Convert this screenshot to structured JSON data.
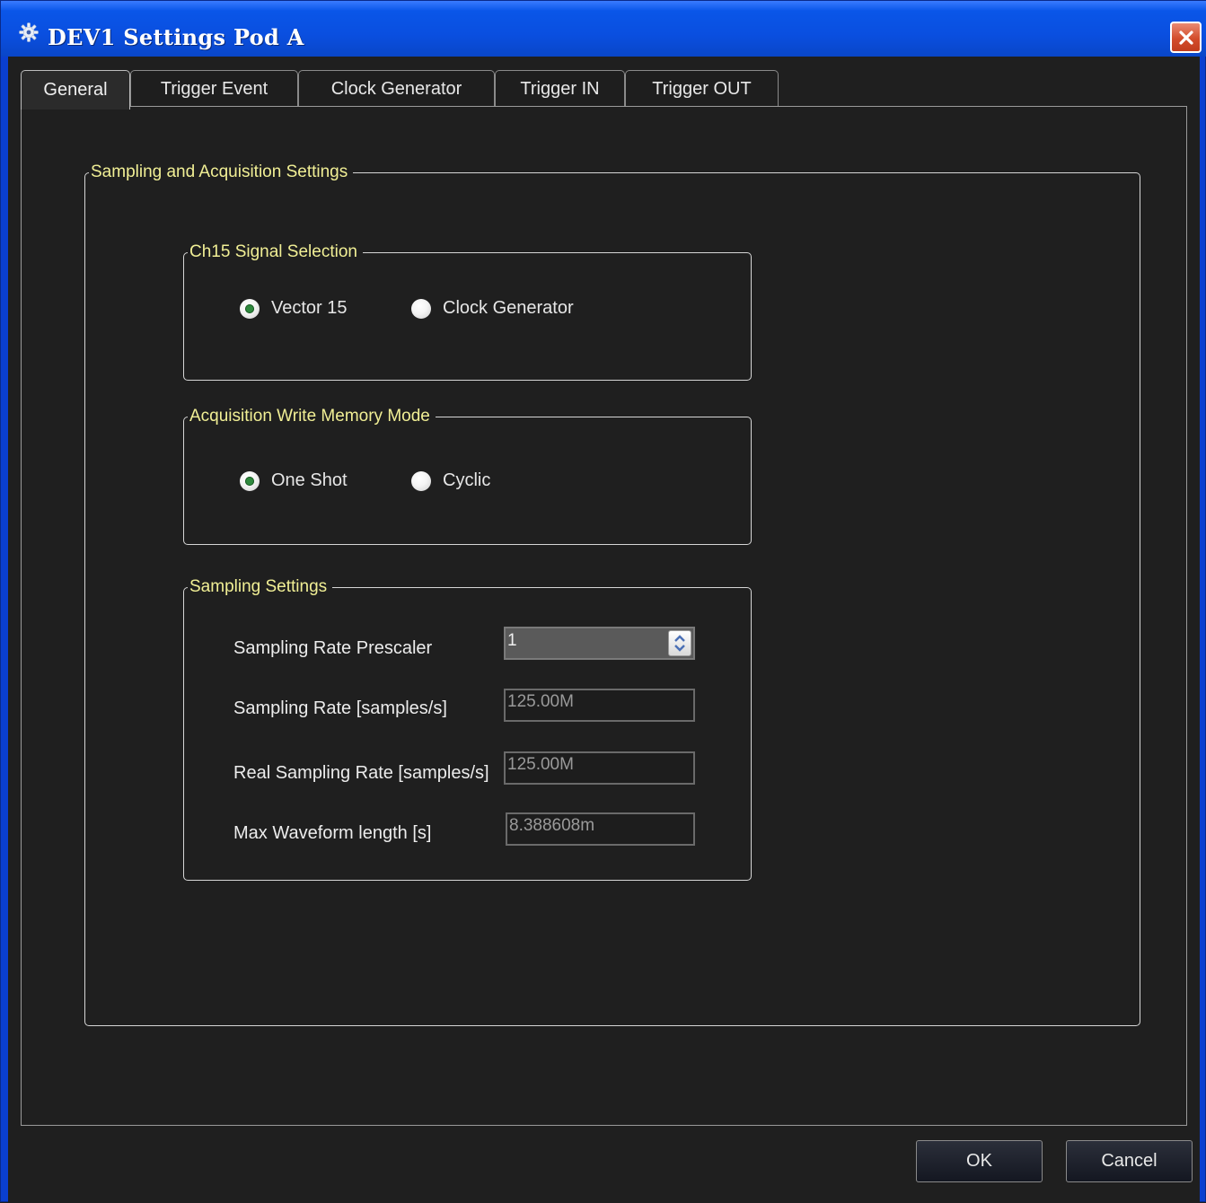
{
  "window": {
    "title": "DEV1 Settings Pod A"
  },
  "tabs": [
    {
      "label": "General",
      "active": true
    },
    {
      "label": "Trigger Event",
      "active": false
    },
    {
      "label": "Clock Generator",
      "active": false
    },
    {
      "label": "Trigger IN",
      "active": false
    },
    {
      "label": "Trigger OUT",
      "active": false
    }
  ],
  "main_group": {
    "title": "Sampling and Acquisition Settings"
  },
  "ch15_group": {
    "title": "Ch15 Signal Selection",
    "options": [
      {
        "label": "Vector 15",
        "checked": true
      },
      {
        "label": "Clock Generator",
        "checked": false
      }
    ]
  },
  "write_mode_group": {
    "title": "Acquisition Write Memory Mode",
    "options": [
      {
        "label": "One Shot",
        "checked": true
      },
      {
        "label": "Cyclic",
        "checked": false
      }
    ]
  },
  "sampling_group": {
    "title": "Sampling Settings",
    "prescaler": {
      "label": "Sampling Rate Prescaler",
      "value": "1"
    },
    "rate": {
      "label": "Sampling Rate [samples/s]",
      "value": "125.00M"
    },
    "real_rate": {
      "label": "Real Sampling Rate [samples/s]",
      "value": "125.00M"
    },
    "max_length": {
      "label": "Max Waveform length [s]",
      "value": "8.388608m"
    }
  },
  "buttons": {
    "ok": "OK",
    "cancel": "Cancel"
  },
  "colors": {
    "titlebar": "#0a4fe0",
    "background": "#1f1f1f",
    "group_title": "#f1ef95",
    "close_button": "#d34d2c",
    "radio_checked": "#2f8a3e"
  }
}
